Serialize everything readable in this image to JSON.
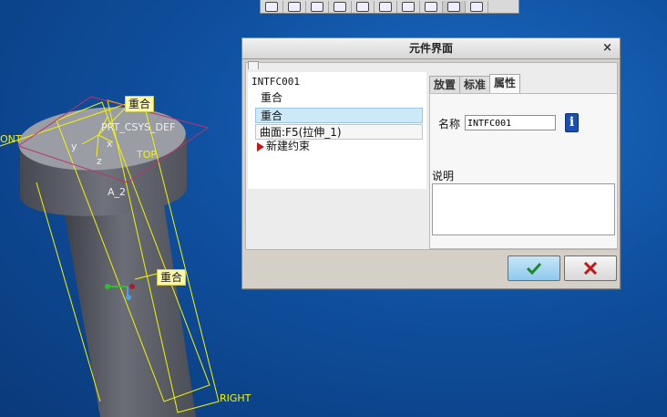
{
  "colors": {
    "viewport_bg": "#0f4f9e",
    "datum_yellow": "#f5f500",
    "tag_bg": "#fbf6a8",
    "ok_green": "#1c8a2a",
    "cancel_red": "#c01818"
  },
  "toolbar": {
    "buttons": [
      "zoom-window-icon",
      "zoom-in-icon",
      "zoom-out-icon",
      "repaint-icon",
      "view-icon",
      "view-manager-icon",
      "saved-views-icon",
      "datum-display-icon",
      "spin-center-icon",
      "annotation-icon"
    ]
  },
  "viewport": {
    "labels": {
      "csys": "PRT_CSYS_DEF",
      "x": "x",
      "y": "y",
      "z": "z",
      "front_partial": "ONT",
      "top": "TOP",
      "axis": "A_2",
      "right": "RIGHT"
    },
    "tags": {
      "coincident_top": "重合",
      "coincident_mid": "重合"
    }
  },
  "dialog": {
    "title": "元件界面",
    "close": "×",
    "tree": {
      "root": "INTFC001",
      "items": [
        "重合",
        "重合"
      ],
      "sub_item": "曲面:F5(拉伸_1)",
      "new_constraint": "新建约束"
    },
    "tabs": [
      "放置",
      "标准",
      "属性"
    ],
    "active_tab": "属性",
    "properties": {
      "name_label": "名称",
      "name_value": "INTFC001",
      "description_label": "说明"
    },
    "buttons": {
      "ok": "ok-check-icon",
      "cancel": "cancel-x-icon"
    }
  }
}
